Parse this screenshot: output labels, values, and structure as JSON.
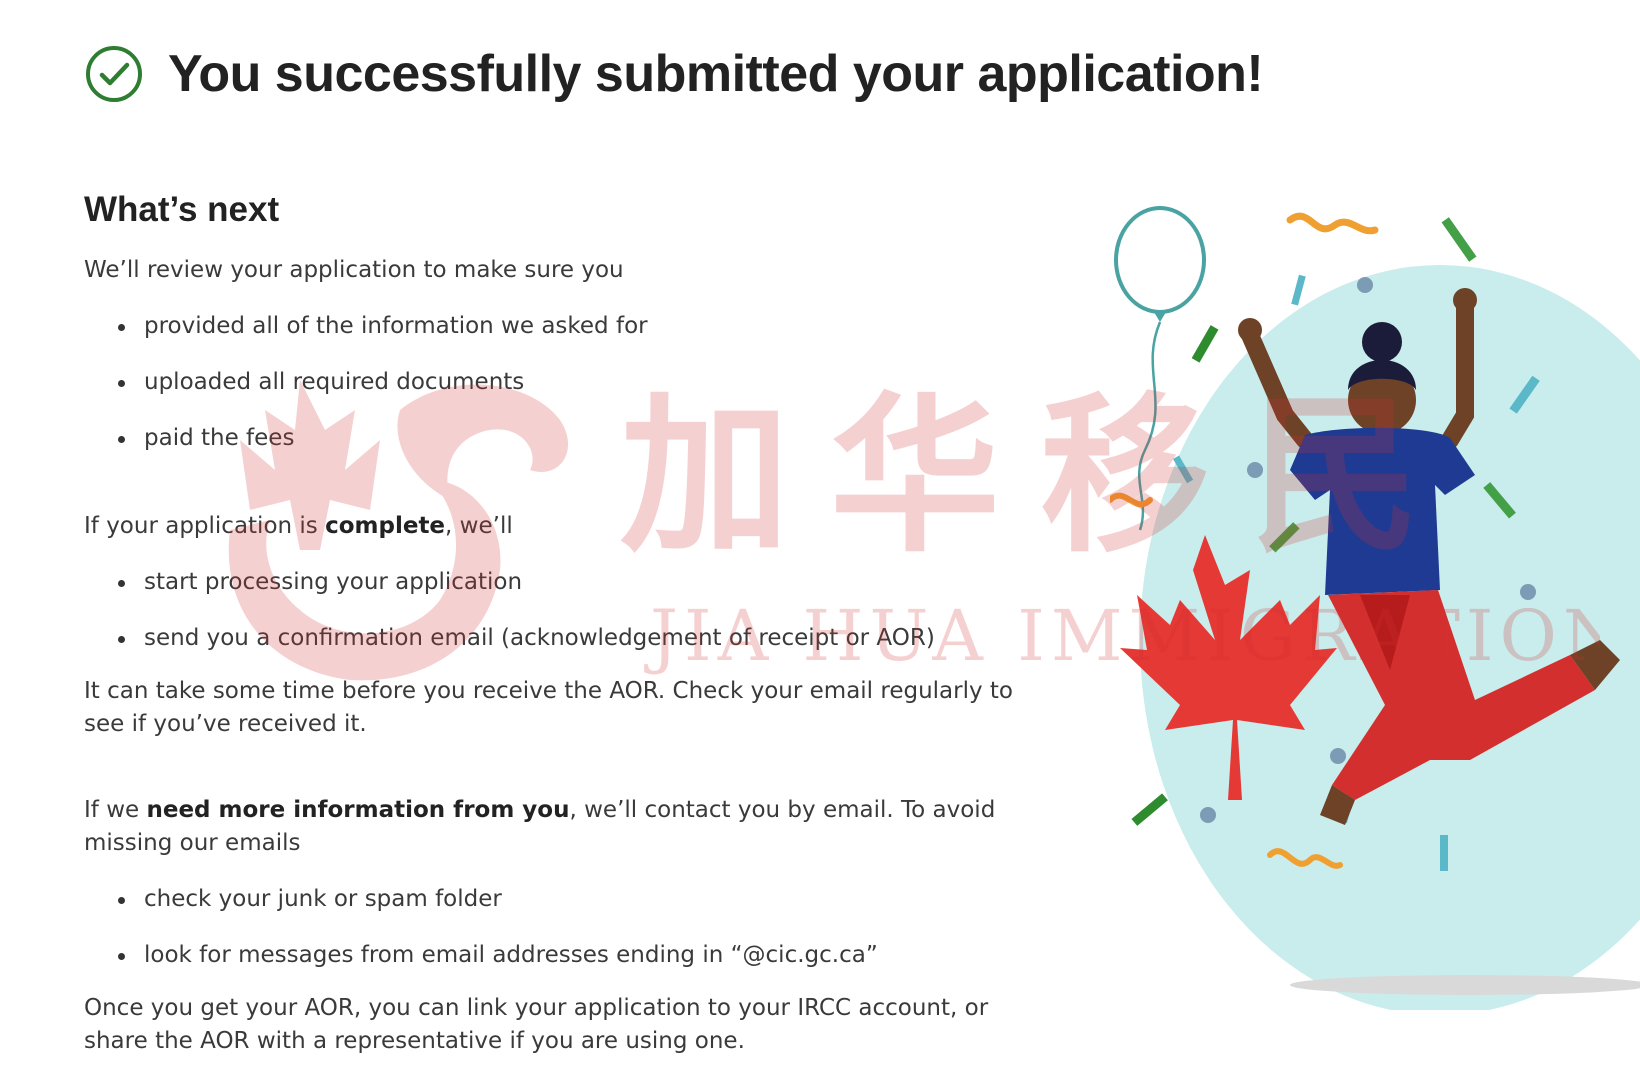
{
  "header": {
    "title": "You successfully submitted your application!",
    "icon": "check-circle-icon",
    "accent_color": "#2e7d32"
  },
  "whats_next": {
    "heading": "What’s next",
    "review_intro": "We’ll review your application to make sure you",
    "review_items": [
      "provided all of the information we asked for",
      "uploaded all required documents",
      "paid the fees"
    ],
    "complete_pre": "If your application is ",
    "complete_bold": "complete",
    "complete_post": ", we’ll",
    "complete_items": [
      "start processing your application",
      "send you a confirmation email (acknowledgement of receipt or AOR)"
    ],
    "aor_time_note": "It can take some time before you receive the AOR. Check your email regularly to see if you’ve received it.",
    "more_info_pre": "If we ",
    "more_info_bold": "need more information from you",
    "more_info_post": ", we’ll contact you by email. To avoid missing our emails",
    "email_items": [
      "check your junk or spam folder",
      "look for messages from email addresses ending in “@cic.gc.ca”"
    ],
    "link_note": "Once you get your AOR, you can link your application to your IRCC account, or share the AOR with a representative if you are using one."
  },
  "watermark": {
    "chinese": "加华移民",
    "english": "JIA HUA IMMIGRATION",
    "color": "#d32f2f"
  },
  "illustration": {
    "name": "celebration-illustration",
    "circle_color": "#c9ecec",
    "leaf_color": "#e53935",
    "shirt_color": "#1f3a93",
    "pants_color": "#d32f2f"
  }
}
